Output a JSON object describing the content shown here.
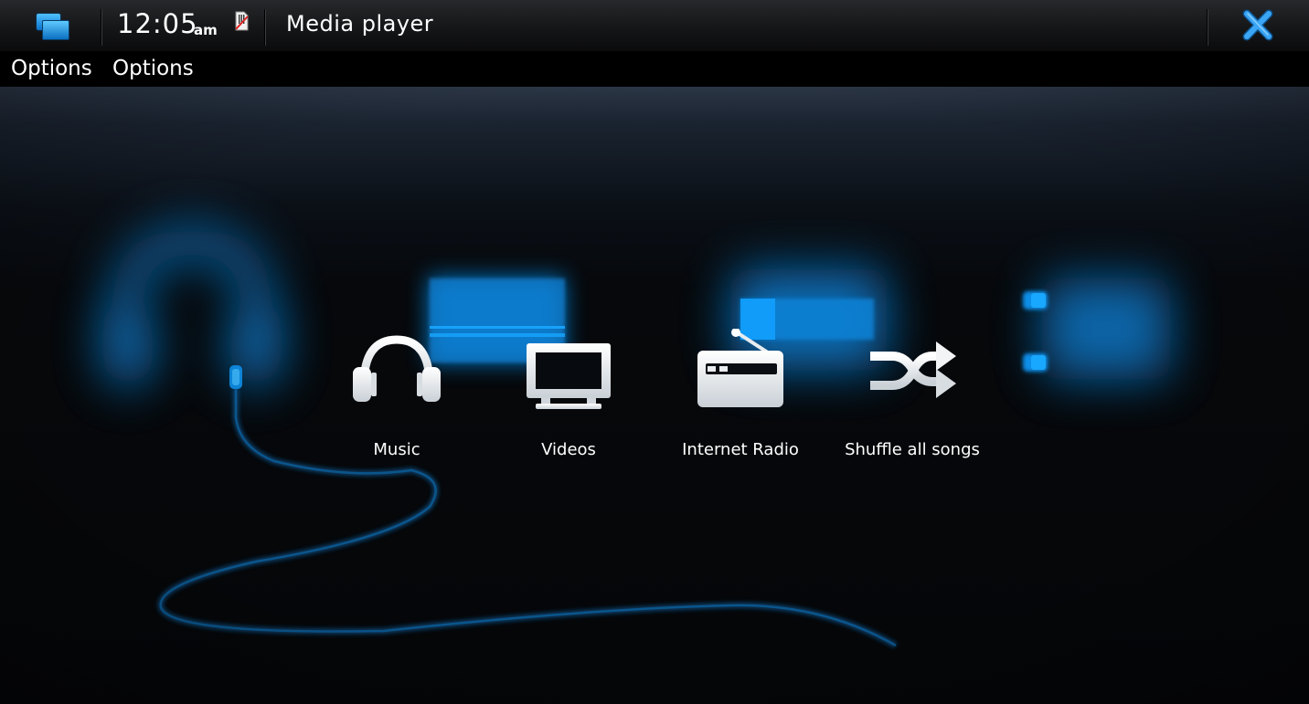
{
  "status_bar": {
    "task_switcher_icon": "task-switcher-icon",
    "clock_time": "12:05",
    "clock_ampm": "am",
    "sim_icon": "sim-card-missing-icon",
    "window_title": "Media player",
    "close_icon": "close-icon"
  },
  "menu_bar": {
    "items": [
      {
        "label": "Options"
      },
      {
        "label": "Options"
      }
    ]
  },
  "main_menu": {
    "items": [
      {
        "label": "Music",
        "icon": "headphones-icon"
      },
      {
        "label": "Videos",
        "icon": "tv-icon"
      },
      {
        "label": "Internet Radio",
        "icon": "radio-icon"
      },
      {
        "label": "Shuffle all songs",
        "icon": "shuffle-icon"
      }
    ]
  },
  "colors": {
    "accent_blue": "#0aa0ff",
    "icon_white": "#e8ecef",
    "close_blue": "#2f9bf0"
  }
}
